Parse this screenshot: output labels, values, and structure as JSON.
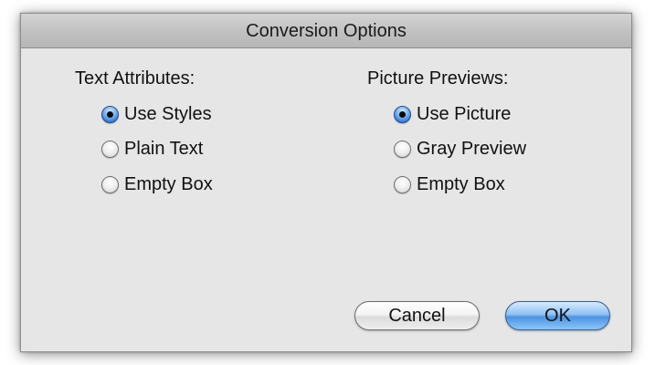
{
  "dialog": {
    "title": "Conversion Options"
  },
  "text_attributes": {
    "label": "Text Attributes:",
    "options": [
      {
        "label": "Use Styles",
        "selected": true
      },
      {
        "label": "Plain Text",
        "selected": false
      },
      {
        "label": "Empty Box",
        "selected": false
      }
    ]
  },
  "picture_previews": {
    "label": "Picture Previews:",
    "options": [
      {
        "label": "Use Picture",
        "selected": true
      },
      {
        "label": "Gray Preview",
        "selected": false
      },
      {
        "label": "Empty Box",
        "selected": false
      }
    ]
  },
  "buttons": {
    "cancel_label": "Cancel",
    "ok_label": "OK"
  },
  "colors": {
    "dialog_background": "#e6e6e6",
    "titlebar": "#c2c2c2",
    "default_button": "#4b93e4",
    "radio_selected": "#2f79d6"
  }
}
